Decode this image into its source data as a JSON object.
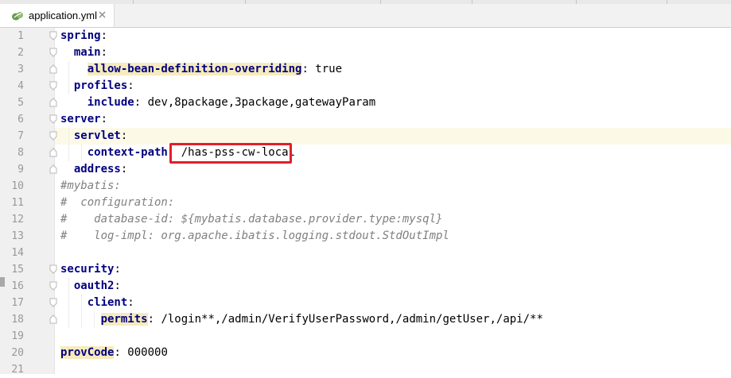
{
  "tab": {
    "file_name": "application.yml",
    "icon": "yaml-leaf-icon",
    "close_icon": "close-icon"
  },
  "colors": {
    "key": "#000080",
    "comment": "#808080",
    "highlight": "#f6ebbc",
    "annotation": "#e0202a"
  },
  "lines": [
    {
      "n": "1",
      "parts": [
        {
          "t": "spring",
          "c": "k"
        },
        {
          "t": ":",
          "c": "v"
        }
      ]
    },
    {
      "n": "2",
      "parts": [
        {
          "t": "  "
        },
        {
          "t": "main",
          "c": "k"
        },
        {
          "t": ":",
          "c": "v"
        }
      ]
    },
    {
      "n": "3",
      "parts": [
        {
          "t": "    "
        },
        {
          "t": "allow-bean-definition-overriding",
          "c": "kh"
        },
        {
          "t": ": true",
          "c": "v"
        }
      ]
    },
    {
      "n": "4",
      "parts": [
        {
          "t": "  "
        },
        {
          "t": "profiles",
          "c": "k"
        },
        {
          "t": ":",
          "c": "v"
        }
      ]
    },
    {
      "n": "5",
      "parts": [
        {
          "t": "    "
        },
        {
          "t": "include",
          "c": "k"
        },
        {
          "t": ": dev,8package,3package,gatewayParam",
          "c": "v"
        }
      ]
    },
    {
      "n": "6",
      "parts": [
        {
          "t": "server",
          "c": "k"
        },
        {
          "t": ":",
          "c": "v"
        }
      ]
    },
    {
      "n": "7",
      "parts": [
        {
          "t": "  "
        },
        {
          "t": "servlet",
          "c": "k"
        },
        {
          "t": ":",
          "c": "v"
        }
      ]
    },
    {
      "n": "8",
      "parts": [
        {
          "t": "    "
        },
        {
          "t": "context-path",
          "c": "k"
        },
        {
          "t": ": /has-pss-cw-local",
          "c": "v"
        }
      ]
    },
    {
      "n": "9",
      "parts": [
        {
          "t": "  "
        },
        {
          "t": "address",
          "c": "k"
        },
        {
          "t": ":",
          "c": "v"
        }
      ]
    },
    {
      "n": "10",
      "parts": [
        {
          "t": "#mybatis:",
          "c": "c"
        }
      ]
    },
    {
      "n": "11",
      "parts": [
        {
          "t": "#  configuration:",
          "c": "c"
        }
      ]
    },
    {
      "n": "12",
      "parts": [
        {
          "t": "#    database-id: ${mybatis.database.provider.type:mysql}",
          "c": "c"
        }
      ]
    },
    {
      "n": "13",
      "parts": [
        {
          "t": "#    log-impl: org.apache.ibatis.logging.stdout.StdOutImpl",
          "c": "c"
        }
      ]
    },
    {
      "n": "14",
      "parts": []
    },
    {
      "n": "15",
      "parts": [
        {
          "t": "security",
          "c": "k"
        },
        {
          "t": ":",
          "c": "v"
        }
      ]
    },
    {
      "n": "16",
      "parts": [
        {
          "t": "  "
        },
        {
          "t": "oauth2",
          "c": "k"
        },
        {
          "t": ":",
          "c": "v"
        }
      ]
    },
    {
      "n": "17",
      "parts": [
        {
          "t": "    "
        },
        {
          "t": "client",
          "c": "k"
        },
        {
          "t": ":",
          "c": "v"
        }
      ]
    },
    {
      "n": "18",
      "parts": [
        {
          "t": "      "
        },
        {
          "t": "permits",
          "c": "kh"
        },
        {
          "t": ": /login**,/admin/VerifyUserPassword,/admin/getUser,/api/**",
          "c": "v"
        }
      ]
    },
    {
      "n": "19",
      "parts": []
    },
    {
      "n": "20",
      "parts": [
        {
          "t": "provCode",
          "c": "kh"
        },
        {
          "t": ": 000000",
          "c": "v"
        }
      ]
    },
    {
      "n": "21",
      "parts": []
    }
  ],
  "caret_line": 7,
  "annotation": "red-box-context-path-value"
}
